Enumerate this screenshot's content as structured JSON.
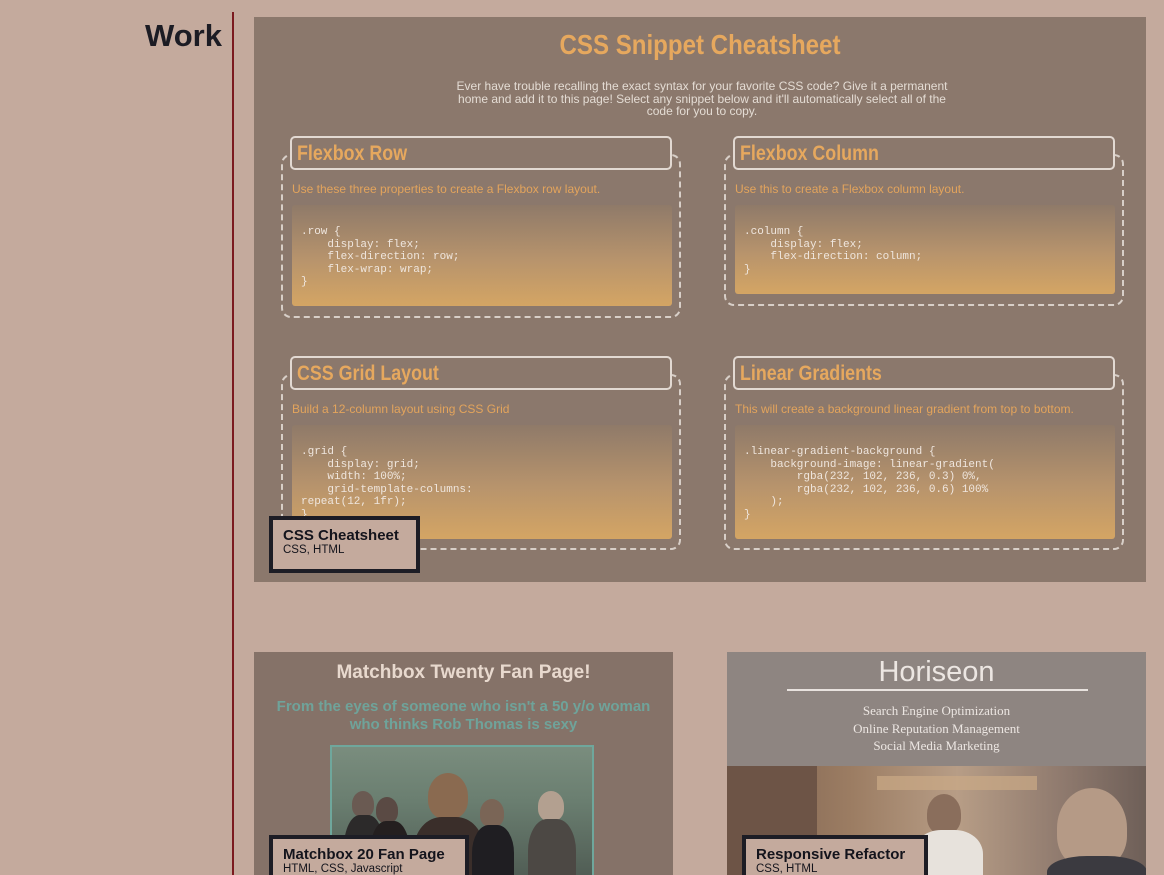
{
  "section": {
    "title": "Work"
  },
  "projects": [
    {
      "title": "CSS Cheatsheet",
      "tech": "CSS, HTML",
      "preview": {
        "heading": "CSS Snippet Cheatsheet",
        "intro": "Ever have trouble recalling the exact syntax for your favorite CSS code? Give it a permanent home and add it to this page! Select any snippet below and it'll automatically select all of the code for you to copy.",
        "snippets": [
          {
            "title": "Flexbox Row",
            "description": "Use these three properties to create a Flexbox row layout.",
            "code": ".row {\n    display: flex;\n    flex-direction: row;\n    flex-wrap: wrap;\n}"
          },
          {
            "title": "Flexbox Column",
            "description": "Use this to create a Flexbox column layout.",
            "code": ".column {\n    display: flex;\n    flex-direction: column;\n}"
          },
          {
            "title": "CSS Grid Layout",
            "description": "Build a 12-column layout using CSS Grid",
            "code": ".grid {\n    display: grid;\n    width: 100%;\n    grid-template-columns:\nrepeat(12, 1fr);\n}"
          },
          {
            "title": "Linear Gradients",
            "description": "This will create a background linear gradient from top to bottom.",
            "code": ".linear-gradient-background {\n    background-image: linear-gradient(\n        rgba(232, 102, 236, 0.3) 0%,\n        rgba(232, 102, 236, 0.6) 100%\n    );\n}"
          }
        ]
      }
    },
    {
      "title": "Matchbox 20 Fan Page",
      "tech": "HTML, CSS, Javascript",
      "preview": {
        "heading": "Matchbox Twenty Fan Page!",
        "subheading": "From the eyes of someone who isn't a 50 y/o woman who thinks Rob Thomas is sexy"
      }
    },
    {
      "title": "Responsive Refactor",
      "tech": "CSS, HTML",
      "preview": {
        "heading": "Horiseon",
        "links": [
          "Search Engine Optimization",
          "Online Reputation Management",
          "Social Media Marketing"
        ]
      }
    }
  ]
}
